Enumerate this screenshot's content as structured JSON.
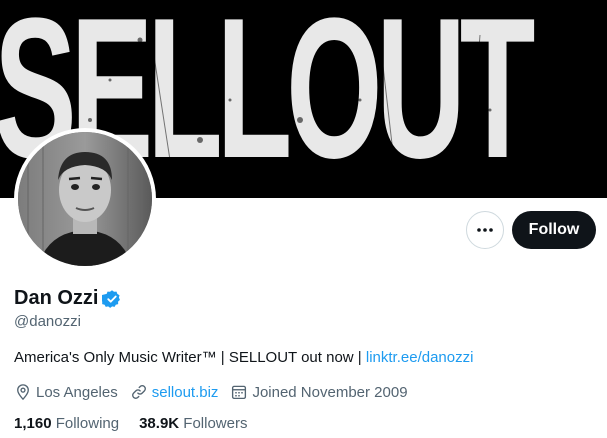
{
  "banner": {
    "text": "SELLOUT"
  },
  "profile": {
    "display_name": "Dan Ozzi",
    "handle": "@danozzi",
    "bio_text": "America's Only Music Writer™ | SELLOUT out now | ",
    "bio_link": "linktr.ee/danozzi",
    "location": "Los Angeles",
    "website": "sellout.biz",
    "joined": "Joined November 2009",
    "following_count": "1,160",
    "following_label": "Following",
    "followers_count": "38.9K",
    "followers_label": "Followers"
  },
  "actions": {
    "follow_label": "Follow",
    "more_icon": "ellipsis-icon"
  },
  "icons": {
    "verified": "verified-badge-icon",
    "location": "location-pin-icon",
    "website": "link-icon",
    "joined": "calendar-icon"
  },
  "colors": {
    "accent": "#1d9bf0",
    "text": "#0f1419",
    "muted": "#536471",
    "button": "#0f1419"
  }
}
